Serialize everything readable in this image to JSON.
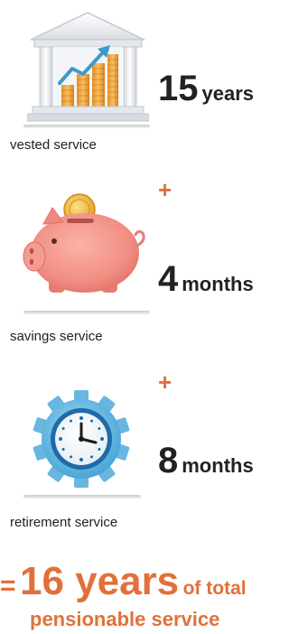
{
  "items": [
    {
      "amount": "15",
      "unit": "years",
      "caption": "vested service",
      "icon": "bank-growth-icon"
    },
    {
      "amount": "4",
      "unit": "months",
      "caption": "savings service",
      "icon": "piggy-bank-icon"
    },
    {
      "amount": "8",
      "unit": "months",
      "caption": "retirement service",
      "icon": "clock-gear-icon"
    }
  ],
  "operator": "+",
  "total": {
    "equals": "=",
    "amount": "16 years",
    "suffix_line1": "of total",
    "suffix_line2": "pensionable service"
  },
  "colors": {
    "accent": "#e2703a",
    "text": "#222222"
  }
}
